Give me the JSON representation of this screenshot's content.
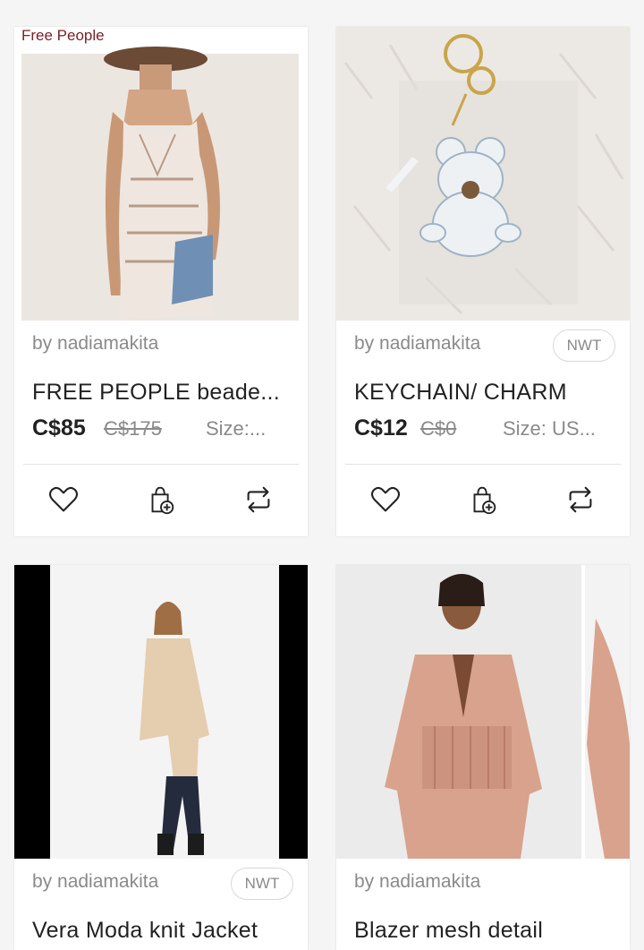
{
  "cards": [
    {
      "brand_tag": "Free People",
      "seller": "by nadiamakita",
      "badge": "",
      "title": "FREE PEOPLE beade...",
      "price": "C$85",
      "original_price": "C$175",
      "size": "Size:...",
      "image": "woman-in-beaded-slip-top"
    },
    {
      "brand_tag": "",
      "seller": "by nadiamakita",
      "badge": "NWT",
      "title": "KEYCHAIN/ CHARM",
      "price": "C$12",
      "original_price": "C$0",
      "size": "Size: US...",
      "image": "teddy-bear-keychain-on-fur"
    },
    {
      "seller": "by nadiamakita",
      "badge": "NWT",
      "title": "Vera Moda knit Jacket",
      "image": "woman-in-beige-coat"
    },
    {
      "seller": "by nadiamakita",
      "badge": "",
      "title": "Blazer mesh detail",
      "image": "woman-in-pink-blazer"
    }
  ],
  "actions": {
    "like": "heart-icon",
    "bundle": "bag-add-icon",
    "share": "share-icon"
  },
  "colors": {
    "brand_tag": "#7a1f2a",
    "text_primary": "#222222",
    "text_secondary": "#8a8a8a"
  }
}
